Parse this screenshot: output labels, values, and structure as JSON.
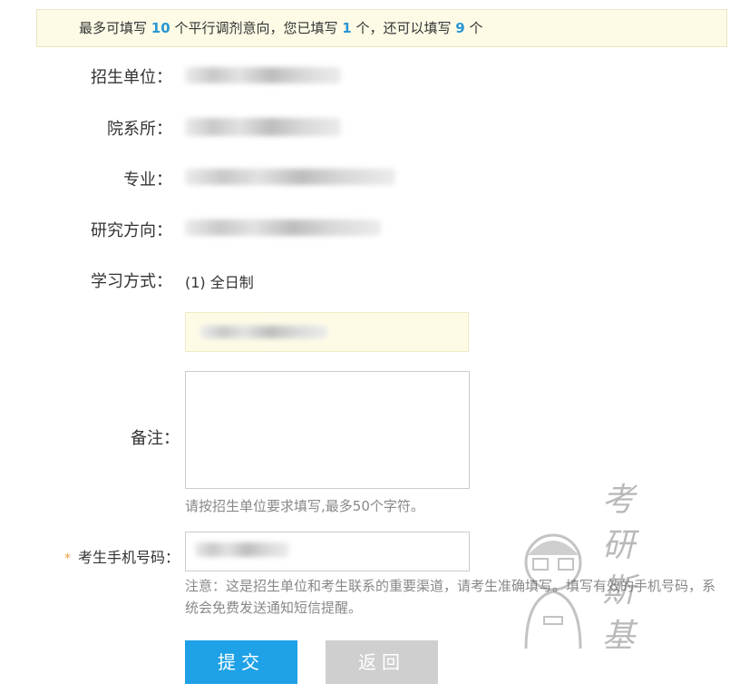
{
  "notice": {
    "prefix": "最多可填写",
    "max": "10",
    "middle": "个平行调剂意向，您已填写",
    "filled": "1",
    "after_filled": "个，还可以填写",
    "remaining": "9",
    "suffix": "个"
  },
  "form": {
    "unit_label": "招生单位：",
    "dept_label": "院系所：",
    "major_label": "专业：",
    "direction_label": "研究方向：",
    "study_mode_label": "学习方式：",
    "study_mode_value": "(1) 全日制",
    "remark_label": "备注：",
    "remark_value": "",
    "remark_hint": "请按招生单位要求填写,最多50个字符。",
    "phone_label": "考生手机号码：",
    "phone_required_mark": "*",
    "phone_hint": "注意：这是招生单位和考生联系的重要渠道，请考生准确填写。填写有效的手机号码，系统会免费发送通知短信提醒。"
  },
  "buttons": {
    "submit": "提交",
    "back": "返回"
  },
  "watermark": {
    "chars": [
      "考",
      "研",
      "斯",
      "基"
    ]
  },
  "colors": {
    "accent": "#1ea1e6",
    "notice_bg": "#fdfbe6",
    "number_highlight": "#2a96d4",
    "back_button": "#cfcfcf",
    "hint_text": "#888888"
  }
}
